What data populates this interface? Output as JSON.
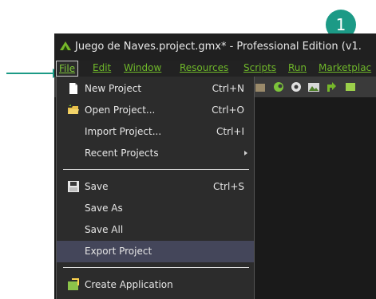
{
  "annotation": {
    "step_number": "1",
    "color": "#1c9a86"
  },
  "window": {
    "title": "Juego de Naves.project.gmx* - Professional Edition (v1."
  },
  "menu_bar": {
    "items": [
      "File",
      "Edit",
      "Window",
      "Resources",
      "Scripts",
      "Run",
      "Marketplac"
    ]
  },
  "toolbar": {
    "icons": [
      "window-icon",
      "gamepad-icon",
      "settings-icon",
      "landscape-icon",
      "export-arrow-icon",
      "module-icon"
    ]
  },
  "file_menu": {
    "items": [
      {
        "label": "New Project",
        "shortcut": "Ctrl+N",
        "icon": "new-file-icon"
      },
      {
        "label": "Open Project...",
        "shortcut": "Ctrl+O",
        "icon": "open-folder-icon"
      },
      {
        "label": "Import Project...",
        "shortcut": "Ctrl+I"
      },
      {
        "label": "Recent Projects",
        "submenu": true
      },
      {
        "label": "Save",
        "shortcut": "Ctrl+S",
        "icon": "floppy-disk-icon"
      },
      {
        "label": "Save As"
      },
      {
        "label": "Save All"
      },
      {
        "label": "Export Project",
        "highlighted": true
      },
      {
        "label": "Create Application"
      }
    ]
  }
}
